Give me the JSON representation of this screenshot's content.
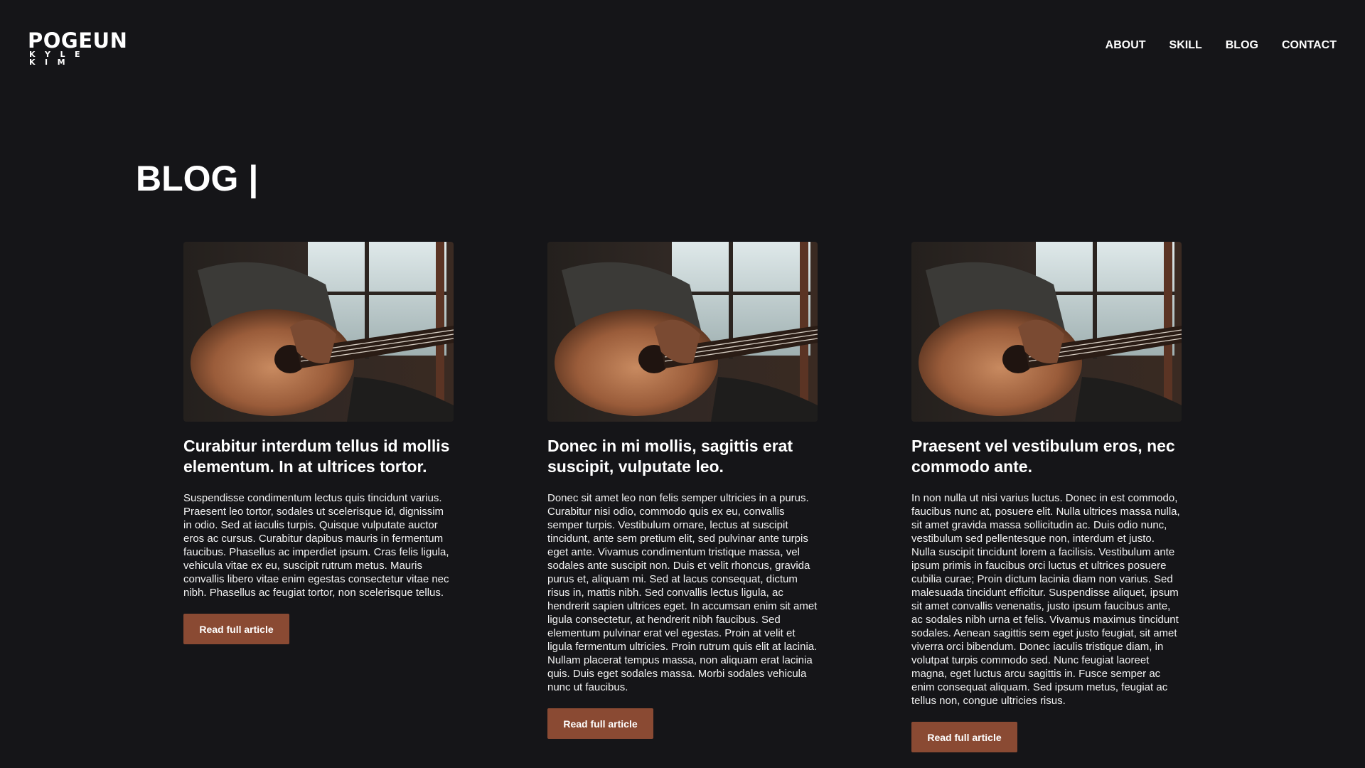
{
  "logo": {
    "main": "POGEUN",
    "sub": "KYLE KIM"
  },
  "nav": {
    "items": [
      "ABOUT",
      "SKILL",
      "BLOG",
      "CONTACT"
    ]
  },
  "blog": {
    "heading": "BLOG |"
  },
  "colors": {
    "background": "#151518",
    "accent": "#8a4a33"
  },
  "cards": [
    {
      "image": "guitar-player-photo",
      "title": "Curabitur interdum tellus id mollis elementum. In at ultrices tortor.",
      "text": "Suspendisse condimentum lectus quis tincidunt varius. Praesent leo tortor, sodales ut scelerisque id, dignissim in odio. Sed at iaculis turpis. Quisque vulputate auctor eros ac cursus. Curabitur dapibus mauris in fermentum faucibus. Phasellus ac imperdiet ipsum. Cras felis ligula, vehicula vitae ex eu, suscipit rutrum metus. Mauris convallis libero vitae enim egestas consectetur vitae nec nibh. Phasellus ac feugiat tortor, non scelerisque tellus.",
      "button": "Read full article"
    },
    {
      "image": "guitar-player-photo",
      "title": "Donec in mi mollis, sagittis erat suscipit, vulputate leo.",
      "text": "Donec sit amet leo non felis semper ultricies in a purus. Curabitur nisi odio, commodo quis ex eu, convallis semper turpis. Vestibulum ornare, lectus at suscipit tincidunt, ante sem pretium elit, sed pulvinar ante turpis eget ante. Vivamus condimentum tristique massa, vel sodales ante suscipit non. Duis et velit rhoncus, gravida purus et, aliquam mi. Sed at lacus consequat, dictum risus in, mattis nibh. Sed convallis lectus ligula, ac hendrerit sapien ultrices eget. In accumsan enim sit amet ligula consectetur, at hendrerit nibh faucibus. Sed elementum pulvinar erat vel egestas. Proin at velit et ligula fermentum ultricies. Proin rutrum quis elit at lacinia. Nullam placerat tempus massa, non aliquam erat lacinia quis. Duis eget sodales massa. Morbi sodales vehicula nunc ut faucibus.",
      "button": "Read full article"
    },
    {
      "image": "guitar-player-photo",
      "title": "Praesent vel vestibulum eros, nec commodo ante.",
      "text": "In non nulla ut nisi varius luctus. Donec in est commodo, faucibus nunc at, posuere elit. Nulla ultrices massa nulla, sit amet gravida massa sollicitudin ac. Duis odio nunc, vestibulum sed pellentesque non, interdum et justo. Nulla suscipit tincidunt lorem a facilisis. Vestibulum ante ipsum primis in faucibus orci luctus et ultrices posuere cubilia curae; Proin dictum lacinia diam non varius. Sed malesuada tincidunt efficitur. Suspendisse aliquet, ipsum sit amet convallis venenatis, justo ipsum faucibus ante, ac sodales nibh urna et felis. Vivamus maximus tincidunt sodales. Aenean sagittis sem eget justo feugiat, sit amet viverra orci bibendum. Donec iaculis tristique diam, in volutpat turpis commodo sed. Nunc feugiat laoreet magna, eget luctus arcu sagittis in. Fusce semper ac enim consequat aliquam. Sed ipsum metus, feugiat ac tellus non, congue ultricies risus.",
      "button": "Read full article"
    }
  ]
}
